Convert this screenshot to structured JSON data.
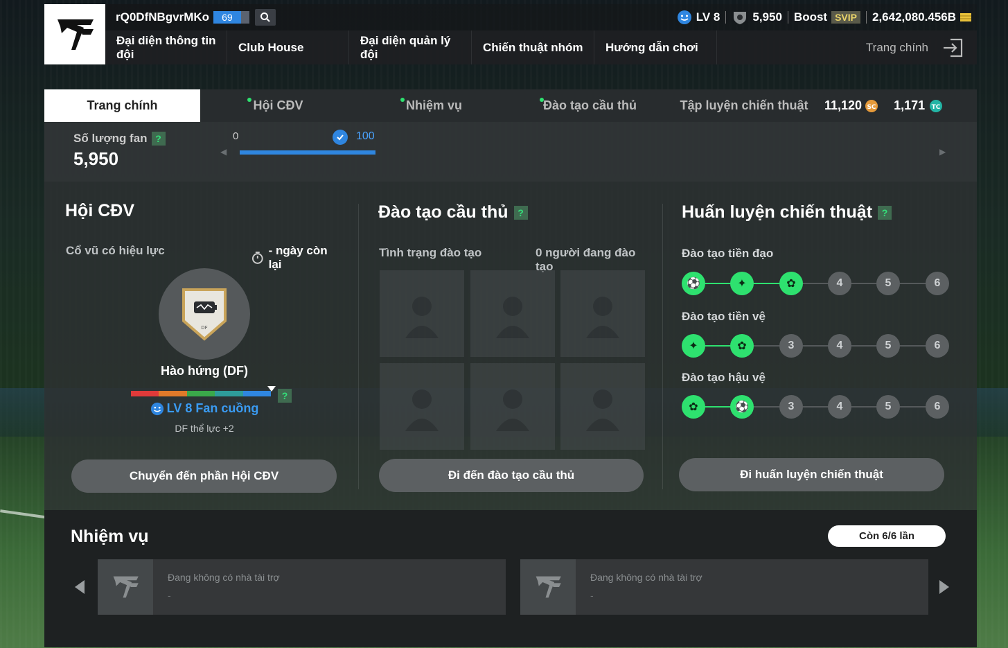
{
  "header": {
    "username": "rQ0DfNBgvrMKo",
    "user_level": "69",
    "stats": {
      "fan_level": "LV 8",
      "fans": "5,950",
      "boost_label": "Boost",
      "svip": "SVIP",
      "coins": "2,642,080.456B"
    },
    "nav": [
      "Đại diện thông tin đội",
      "Club House",
      "Đại diện quản lý đội",
      "Chiến thuật nhóm",
      "Hướng dẫn chơi"
    ],
    "home_link": "Trang chính"
  },
  "tabs": {
    "items": [
      "Trang chính",
      "Hội CĐV",
      "Nhiệm vụ",
      "Đào tạo cầu thủ",
      "Tập luyện chiến thuật"
    ],
    "sc_amount": "11,120",
    "tc_amount": "1,171"
  },
  "fan_bar": {
    "label": "Số lượng fan",
    "value": "5,950",
    "start": "0",
    "target": "100",
    "progress": 1.0
  },
  "fan_club": {
    "title": "Hội CĐV",
    "cheer_label": "Cổ vũ có hiệu lực",
    "days_left": "- ngày còn lại",
    "badge_tag": "DF",
    "badge_name": "Hào hứng (DF)",
    "level_text": "LV 8 Fan cuồng",
    "bonus": "DF thể lực +2",
    "button": "Chuyển đến phần Hội CĐV"
  },
  "player_training": {
    "title": "Đào tạo cầu thủ",
    "status_label": "Tình trạng đào tạo",
    "count_label": "0 người đang đào tạo",
    "button": "Đi đến đào tạo cầu thủ"
  },
  "tactic_training": {
    "title": "Huấn luyện chiến thuật",
    "rows": [
      {
        "label": "Đào tạo tiền đạo",
        "done": 3,
        "nodes": [
          "",
          "",
          "",
          "4",
          "5",
          "6"
        ]
      },
      {
        "label": "Đào tạo tiền vệ",
        "done": 2,
        "nodes": [
          "",
          "",
          "3",
          "4",
          "5",
          "6"
        ]
      },
      {
        "label": "Đào tạo hậu vệ",
        "done": 2,
        "nodes": [
          "",
          "",
          "3",
          "4",
          "5",
          "6"
        ]
      }
    ],
    "button": "Đi huấn luyện chiến thuật"
  },
  "missions": {
    "title": "Nhiệm vụ",
    "remaining": "Còn 6/6 lần",
    "cards": [
      {
        "text": "Đang không có nhà tài trợ",
        "sub": "-"
      },
      {
        "text": "Đang không có nhà tài trợ",
        "sub": "-"
      }
    ]
  },
  "colors": {
    "accent_green": "#2ee16f",
    "accent_blue": "#2f86e0",
    "rainbow": [
      "#e03a3a",
      "#e07a2a",
      "#3aa84a",
      "#2e9c9a",
      "#2f86e0"
    ]
  }
}
